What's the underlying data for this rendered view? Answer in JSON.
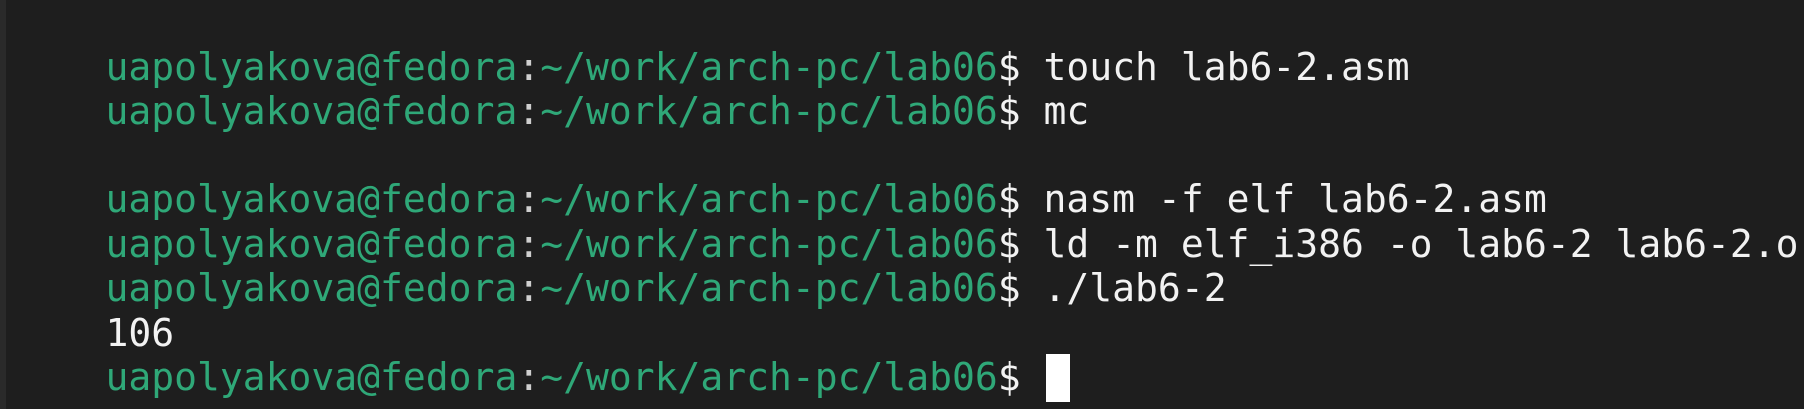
{
  "terminal": {
    "prompt": {
      "user_host": "uapolyakova@fedora",
      "separator": ":",
      "path": "~/work/arch-pc/lab06",
      "symbol": "$ "
    },
    "lines": [
      {
        "type": "command",
        "text": "touch lab6-2.asm"
      },
      {
        "type": "command",
        "text": "mc"
      },
      {
        "type": "blank",
        "text": ""
      },
      {
        "type": "command",
        "text": "nasm -f elf lab6-2.asm"
      },
      {
        "type": "command",
        "text": "ld -m elf_i386 -o lab6-2 lab6-2.o"
      },
      {
        "type": "command",
        "text": "./lab6-2"
      },
      {
        "type": "output",
        "text": "106"
      },
      {
        "type": "command",
        "text": ""
      }
    ],
    "colors": {
      "background": "#1e1e1e",
      "prompt_green": "#2fa878",
      "text": "#f2f2f2",
      "cursor": "#ffffff"
    }
  }
}
